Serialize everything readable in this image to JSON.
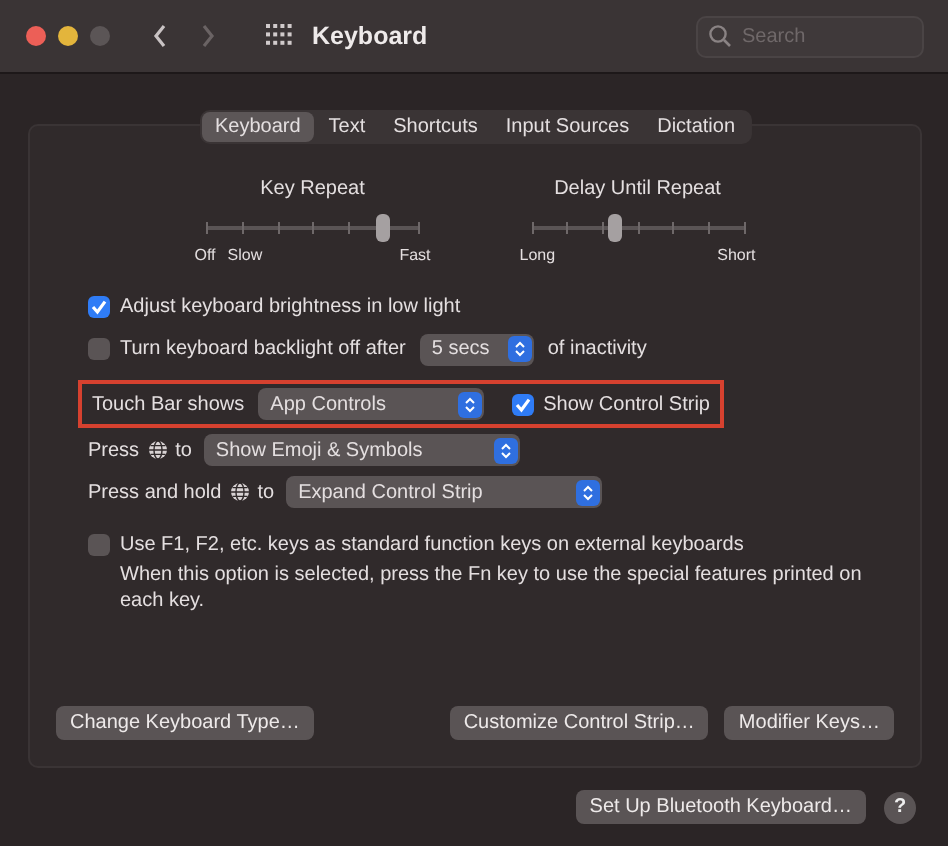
{
  "window": {
    "title": "Keyboard",
    "search": {
      "placeholder": "Search"
    },
    "forward_disabled": true
  },
  "tabs": [
    {
      "label": "Keyboard",
      "selected": true
    },
    {
      "label": "Text",
      "selected": false
    },
    {
      "label": "Shortcuts",
      "selected": false
    },
    {
      "label": "Input Sources",
      "selected": false
    },
    {
      "label": "Dictation",
      "selected": false
    }
  ],
  "sliders": [
    {
      "title": "Key Repeat",
      "level": 0.84,
      "left_labels": [
        "Off",
        "Slow"
      ],
      "right_labels": [
        "Fast"
      ]
    },
    {
      "title": "Delay Until Repeat",
      "level": 0.4,
      "left_labels": [
        "Long"
      ],
      "right_labels": [
        "Short"
      ]
    }
  ],
  "options": [
    {
      "kind": "checkbox",
      "label": "Adjust keyboard brightness in low light",
      "checked": true
    },
    {
      "kind": "checkbox-select",
      "label": "Turn keyboard backlight off after",
      "checked": false,
      "select": "5 secs",
      "suffix": "of inactivity"
    }
  ],
  "touch_bar": {
    "highlighted": true,
    "label": "Touch Bar shows",
    "select": "App Controls",
    "checkbox_label": "Show Control Strip",
    "checked": true
  },
  "globe_rows": [
    {
      "prefix": "Press",
      "suffix": "to",
      "select": "Show Emoji & Symbols"
    },
    {
      "prefix": "Press and hold",
      "suffix": "to",
      "select": "Expand Control Strip"
    }
  ],
  "fn_option": {
    "label": "Use F1, F2, etc. keys as standard function keys on external keyboards",
    "checked": false,
    "description": "When this option is selected, press the Fn key to use the special features printed on each key."
  },
  "buttons": [
    "Change Keyboard Type…",
    "Customize Control Strip…",
    "Modifier Keys…"
  ],
  "footer": {
    "button": "Set Up Bluetooth Keyboard…",
    "help": "?"
  }
}
